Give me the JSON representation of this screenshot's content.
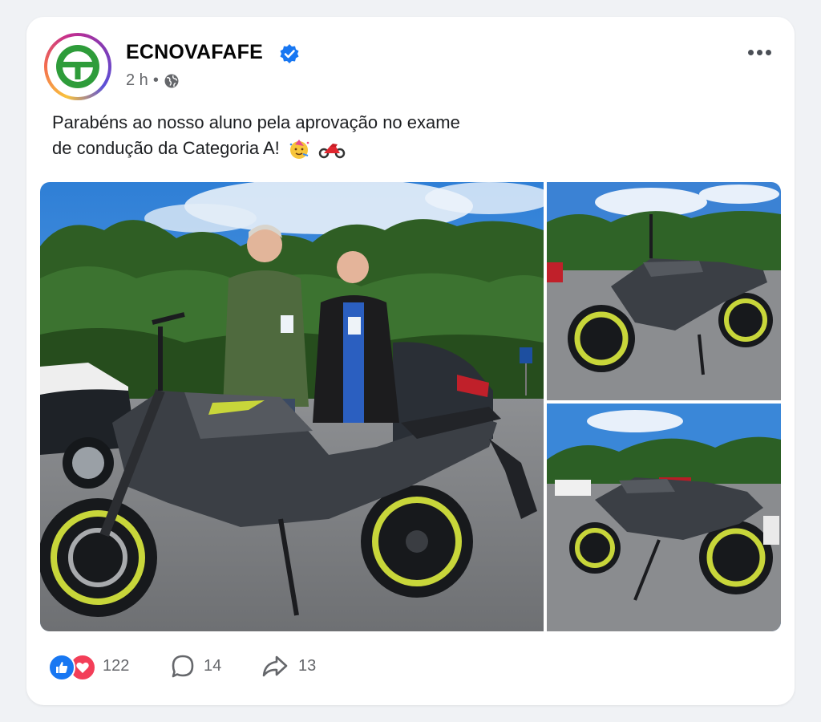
{
  "post": {
    "page_name": "ECNOVAFAFE",
    "time": "2 h",
    "separator": "•",
    "audience_icon": "globe-icon",
    "caption_line1": "Parabéns ao nosso aluno pela aprovação no exame",
    "caption_line2": "de condução da Categoria A!",
    "caption_emojis": [
      "partying-face",
      "motorcycle"
    ]
  },
  "photos": [
    {
      "name": "photo-main",
      "description_icon": "motorcycle-with-two-men"
    },
    {
      "name": "photo-top-right",
      "description_icon": "motorcycle-side-view"
    },
    {
      "name": "photo-bottom-right",
      "description_icon": "motorcycle-rear-view"
    }
  ],
  "engagement": {
    "reactions": [
      "like",
      "love"
    ],
    "reaction_count": "122",
    "comment_count": "14",
    "share_count": "13"
  },
  "colors": {
    "like": "#1877f2",
    "love": "#f33e58",
    "verified": "#1877f2",
    "logo_green": "#2e9c3a"
  }
}
